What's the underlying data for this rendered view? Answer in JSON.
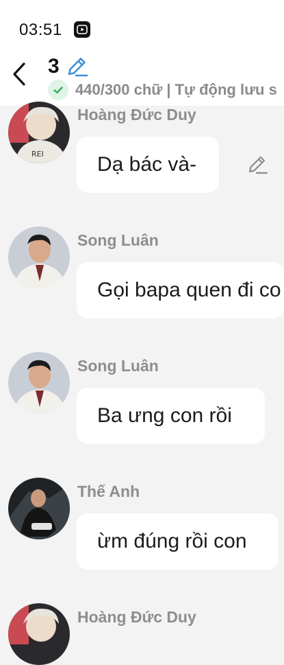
{
  "status_bar": {
    "time": "03:51",
    "app_icon": "video-play-icon"
  },
  "header": {
    "back_icon": "chevron-left-icon",
    "chapter_number": "3",
    "edit_icon": "pencil-icon",
    "save_status_icon": "check-icon",
    "save_status": "440/300 chữ | Tự động lưu s"
  },
  "messages": [
    {
      "sender": "Hoàng Đức Duy",
      "text": "Dạ bác và-",
      "avatar": "avatar-hoang-duc-duy",
      "edit_icon": "pencil-icon"
    },
    {
      "sender": "Song Luân",
      "text": "Gọi bapa quen đi co",
      "avatar": "avatar-song-luan"
    },
    {
      "sender": "Song Luân",
      "text": "Ba ưng con rồi",
      "avatar": "avatar-song-luan"
    },
    {
      "sender": "Thế Anh",
      "text": "ừm đúng rồi con",
      "avatar": "avatar-the-anh"
    },
    {
      "sender": "Hoàng Đức Duy",
      "text": "",
      "avatar": "avatar-hoang-duc-duy"
    }
  ],
  "colors": {
    "background": "#f3f3f3",
    "bubble": "#ffffff",
    "sender_text": "#8e8e8e",
    "edit_accent": "#3b8fd9",
    "save_check": "#2fae5a"
  }
}
